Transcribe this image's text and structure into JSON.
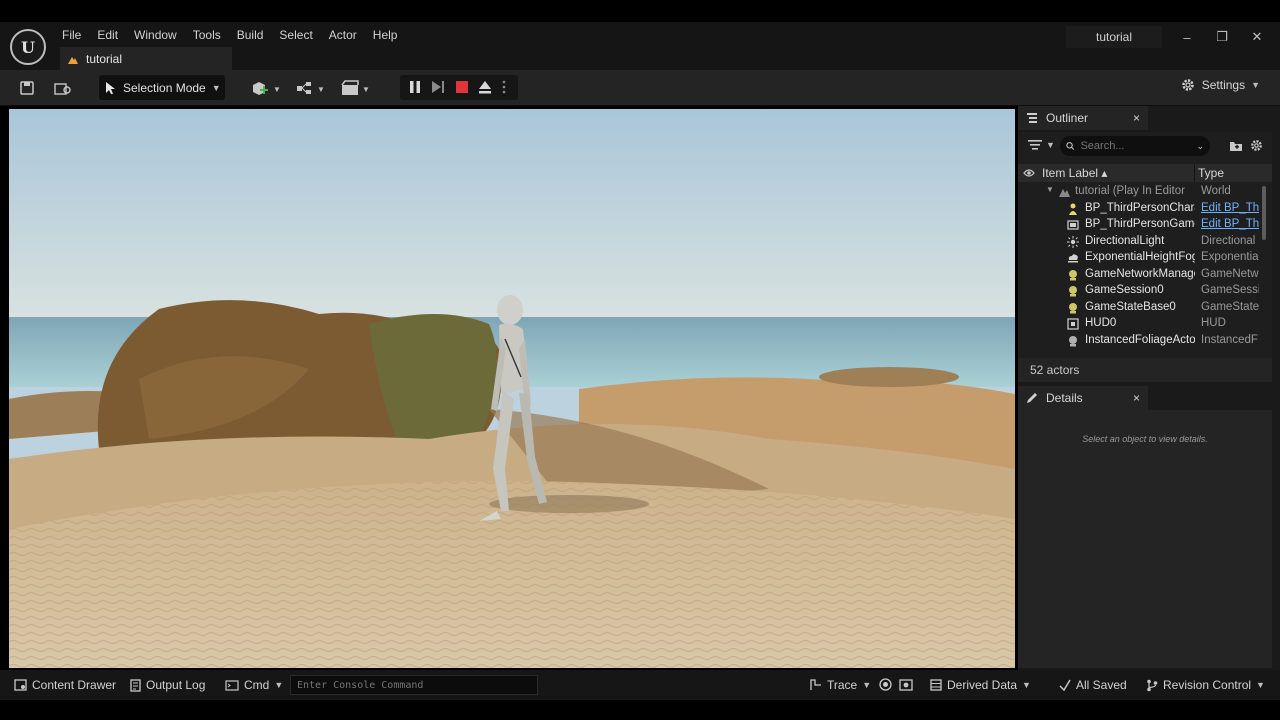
{
  "app": {
    "logo": "unreal-engine-logo",
    "project_name": "tutorial"
  },
  "menu": [
    "File",
    "Edit",
    "Window",
    "Tools",
    "Build",
    "Select",
    "Actor",
    "Help"
  ],
  "document_tab": {
    "label": "tutorial"
  },
  "window_controls": {
    "minimize": "–",
    "maximize": "❐",
    "close": "✕"
  },
  "toolbar": {
    "selection_mode_label": "Selection Mode",
    "settings_label": "Settings"
  },
  "outliner": {
    "tab_label": "Outliner",
    "close": "×",
    "search_placeholder": "Search...",
    "column_item_label": "Item Label ▴",
    "column_type": "Type",
    "rows": [
      {
        "label": "tutorial (Play In Editor)",
        "type": "World",
        "icon": "world-icon"
      },
      {
        "label": "BP_ThirdPersonChara",
        "type": "Edit BP_Th",
        "type_is_link": true,
        "icon": "character-icon"
      },
      {
        "label": "BP_ThirdPersonGame",
        "type": "Edit BP_Th",
        "type_is_link": true,
        "icon": "gamemode-icon"
      },
      {
        "label": "DirectionalLight",
        "type": "Directional",
        "icon": "light-icon"
      },
      {
        "label": "ExponentialHeightFog",
        "type": "Exponentia",
        "icon": "fog-icon"
      },
      {
        "label": "GameNetworkManage",
        "type": "GameNetw",
        "icon": "actor-icon"
      },
      {
        "label": "GameSession0",
        "type": "GameSessi",
        "icon": "actor-icon"
      },
      {
        "label": "GameStateBase0",
        "type": "GameState",
        "icon": "actor-icon"
      },
      {
        "label": "HUD0",
        "type": "HUD",
        "icon": "hud-icon"
      },
      {
        "label": "InstancedFoliageActo",
        "type": "InstancedF",
        "icon": "actor-icon"
      }
    ],
    "actor_count": "52 actors"
  },
  "details": {
    "tab_label": "Details",
    "close": "×",
    "hint": "Select an object to view details."
  },
  "statusbar": {
    "content_drawer": "Content Drawer",
    "output_log": "Output Log",
    "cmd": "Cmd",
    "console_placeholder": "Enter Console Command",
    "trace": "Trace",
    "derived_data": "Derived Data",
    "all_saved": "All Saved",
    "revision_control": "Revision Control"
  },
  "colors": {
    "panel": "#242424",
    "background": "#151515",
    "link": "#6fb2ff",
    "stop_red": "#e0353d"
  }
}
